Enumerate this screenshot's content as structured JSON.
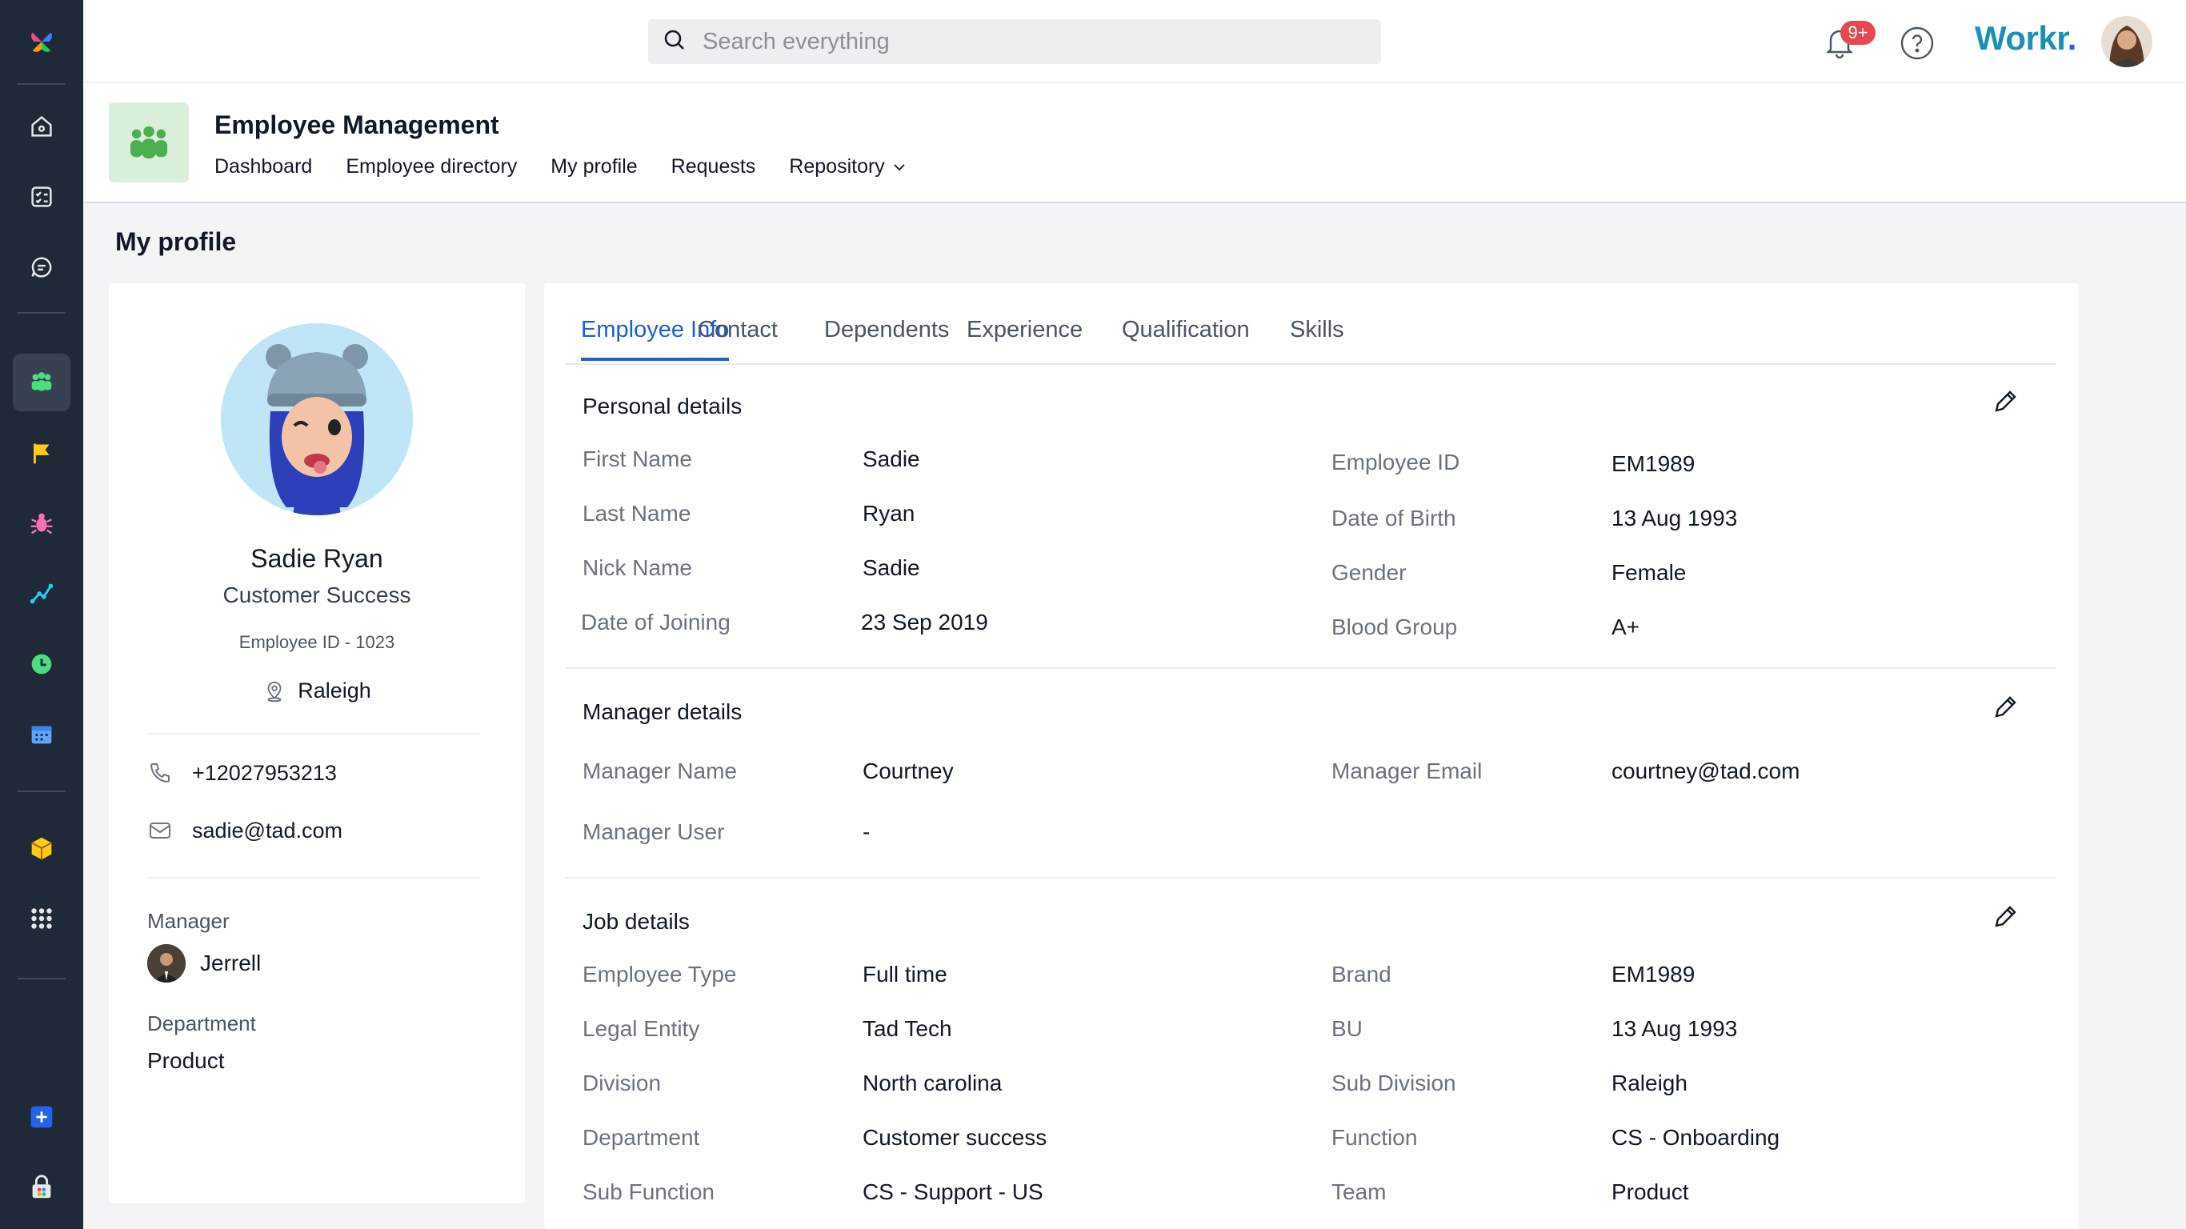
{
  "topbar": {
    "search_placeholder": "Search everything",
    "notification_badge": "9+",
    "brand": "Workr",
    "brand_dot": "."
  },
  "module": {
    "title": "Employee Management",
    "nav": [
      "Dashboard",
      "Employee directory",
      "My profile",
      "Requests",
      "Repository"
    ]
  },
  "page_title": "My profile",
  "profile": {
    "name": "Sadie Ryan",
    "role": "Customer Success",
    "employee_id": "Employee  ID - 1023",
    "location": "Raleigh",
    "phone": "+12027953213",
    "email": "sadie@tad.com",
    "manager_label": "Manager",
    "manager_name": "Jerrell",
    "department_label": "Department",
    "department": "Product"
  },
  "tabs": [
    "Employee Info",
    "Contact",
    "Dependents",
    "Experience",
    "Qualification",
    "Skills"
  ],
  "sections": {
    "personal": {
      "title": "Personal details",
      "left": [
        {
          "label": "First Name",
          "value": "Sadie"
        },
        {
          "label": "Last Name",
          "value": "Ryan"
        },
        {
          "label": "Nick Name",
          "value": "Sadie"
        },
        {
          "label": "Date of Joining",
          "value": "23 Sep 2019"
        }
      ],
      "right": [
        {
          "label": "Employee ID",
          "value": "EM1989"
        },
        {
          "label": "Date of Birth",
          "value": "13 Aug 1993"
        },
        {
          "label": "Gender",
          "value": "Female"
        },
        {
          "label": "Blood Group",
          "value": "A+"
        }
      ]
    },
    "manager": {
      "title": "Manager details",
      "left": [
        {
          "label": "Manager Name",
          "value": "Courtney"
        },
        {
          "label": "Manager User",
          "value": "-"
        }
      ],
      "right": [
        {
          "label": "Manager Email",
          "value": "courtney@tad.com"
        }
      ]
    },
    "job": {
      "title": "Job details",
      "left": [
        {
          "label": "Employee Type",
          "value": "Full time"
        },
        {
          "label": "Legal Entity",
          "value": "Tad Tech"
        },
        {
          "label": "Division",
          "value": "North carolina"
        },
        {
          "label": "Department",
          "value": "Customer success"
        },
        {
          "label": "Sub Function",
          "value": "CS - Support - US"
        }
      ],
      "right": [
        {
          "label": "Brand",
          "value": "EM1989"
        },
        {
          "label": "BU",
          "value": "13 Aug 1993"
        },
        {
          "label": "Sub Division",
          "value": "Raleigh"
        },
        {
          "label": "Function",
          "value": "CS - Onboarding"
        },
        {
          "label": "Team",
          "value": "Product"
        }
      ]
    }
  },
  "colors": {
    "sidebar_bg": "#1f2937",
    "accent_blue": "#1d5fd6",
    "brand_teal": "#1b8fb8",
    "module_icon_green": "#4caf50",
    "badge_red": "#e5484d"
  },
  "icons": {
    "sidebar": [
      "app-logo-icon",
      "home-icon",
      "tasks-icon",
      "chat-icon",
      "people-icon",
      "flag-icon",
      "bug-icon",
      "analytics-icon",
      "clock-icon",
      "calendar-icon",
      "package-icon",
      "grid-icon",
      "add-icon",
      "store-icon"
    ],
    "topbar": [
      "search-icon",
      "bell-icon",
      "help-icon"
    ]
  }
}
